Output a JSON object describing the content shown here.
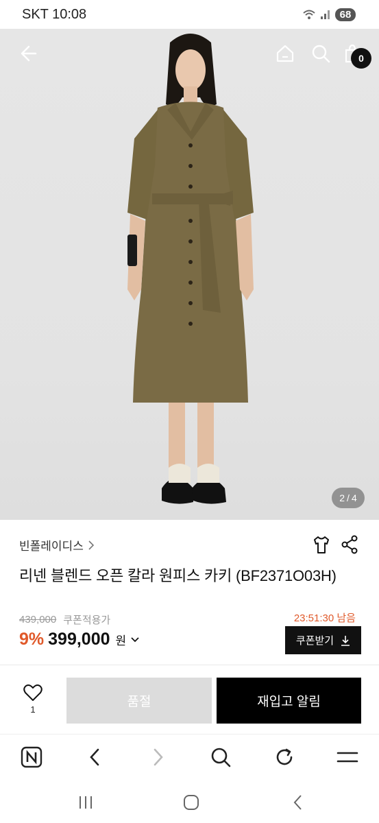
{
  "status_bar": {
    "carrier_time": "SKT 10:08",
    "battery": "68"
  },
  "hero": {
    "page_current": "2",
    "page_separator": "/",
    "page_total": "4",
    "cart_count": "0"
  },
  "product": {
    "brand": "빈폴레이디스",
    "title": "리넨 블렌드 오픈 칼라 원피스 카키 (BF2371O03H)",
    "original_price": "439,000",
    "coupon_applied_label": "쿠폰적용가",
    "timer": "23:51:30 남음",
    "discount": "9%",
    "sale_price": "399,000",
    "currency": "원",
    "coupon_button": "쿠폰받기"
  },
  "actions": {
    "like_count": "1",
    "soldout_label": "품절",
    "restock_label": "재입고 알림"
  },
  "colors": {
    "accent": "#e0592a",
    "dark": "#111111",
    "disabled": "#dcdcdc",
    "dress": "#7a6b45"
  }
}
